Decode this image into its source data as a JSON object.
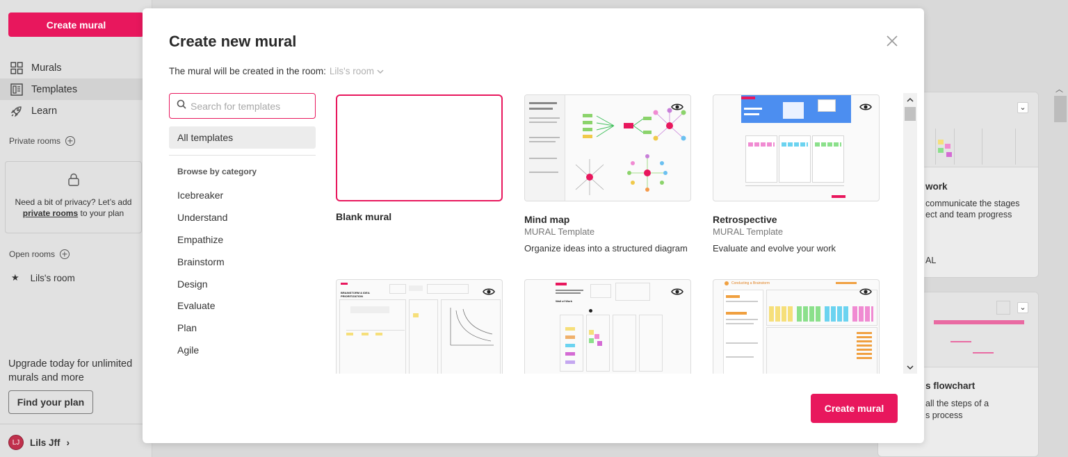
{
  "sidebar": {
    "create_label": "Create mural",
    "nav": [
      {
        "label": "Murals",
        "icon": "grid-icon",
        "active": false
      },
      {
        "label": "Templates",
        "icon": "templates-icon",
        "active": true
      },
      {
        "label": "Learn",
        "icon": "rocket-icon",
        "active": false
      }
    ],
    "private_rooms_label": "Private rooms",
    "privacy_text_1": "Need a bit of privacy? Let’s add",
    "privacy_link": "private rooms",
    "privacy_text_2": "to your plan",
    "open_rooms_label": "Open rooms",
    "rooms": [
      {
        "label": "Lils's room",
        "icon": "star-icon"
      }
    ],
    "upgrade_text": "Upgrade today for unlimited murals and more",
    "find_plan_label": "Find your plan",
    "user": {
      "initials": "LJ",
      "name": "Lils Jff"
    }
  },
  "background": {
    "card_1": {
      "title": "work",
      "desc_1": "communicate the stages",
      "desc_2": "ect and team progress",
      "meta": "AL"
    },
    "card_2": {
      "title": "s flowchart",
      "desc_1": "all the steps of a",
      "desc_2": "s process"
    }
  },
  "modal": {
    "title": "Create new mural",
    "room_prefix": "The mural will be created in the room:",
    "room_name": "Lils's room",
    "search_placeholder": "Search for templates",
    "all_templates_label": "All templates",
    "browse_label": "Browse by category",
    "categories": [
      "Icebreaker",
      "Understand",
      "Empathize",
      "Brainstorm",
      "Design",
      "Evaluate",
      "Plan",
      "Agile"
    ],
    "templates": [
      {
        "name": "Blank mural",
        "sub": "",
        "desc": ""
      },
      {
        "name": "Mind map",
        "sub": "MURAL Template",
        "desc": "Organize ideas into a structured diagram"
      },
      {
        "name": "Retrospective",
        "sub": "MURAL Template",
        "desc": "Evaluate and evolve your work"
      },
      {
        "name": "",
        "sub": "",
        "desc": "",
        "thumb_title": "BRAINSTORM & IDEA PRIORITIZATION"
      },
      {
        "name": "",
        "sub": "",
        "desc": "",
        "thumb_title": "Wall of Work"
      },
      {
        "name": "",
        "sub": "",
        "desc": "",
        "thumb_title": "Conducting a Brainstorm"
      }
    ],
    "create_label": "Create mural"
  },
  "colors": {
    "accent": "#e8175d",
    "sidebar_bg": "#e1e1e1",
    "overlay": "#d9d9d9"
  }
}
